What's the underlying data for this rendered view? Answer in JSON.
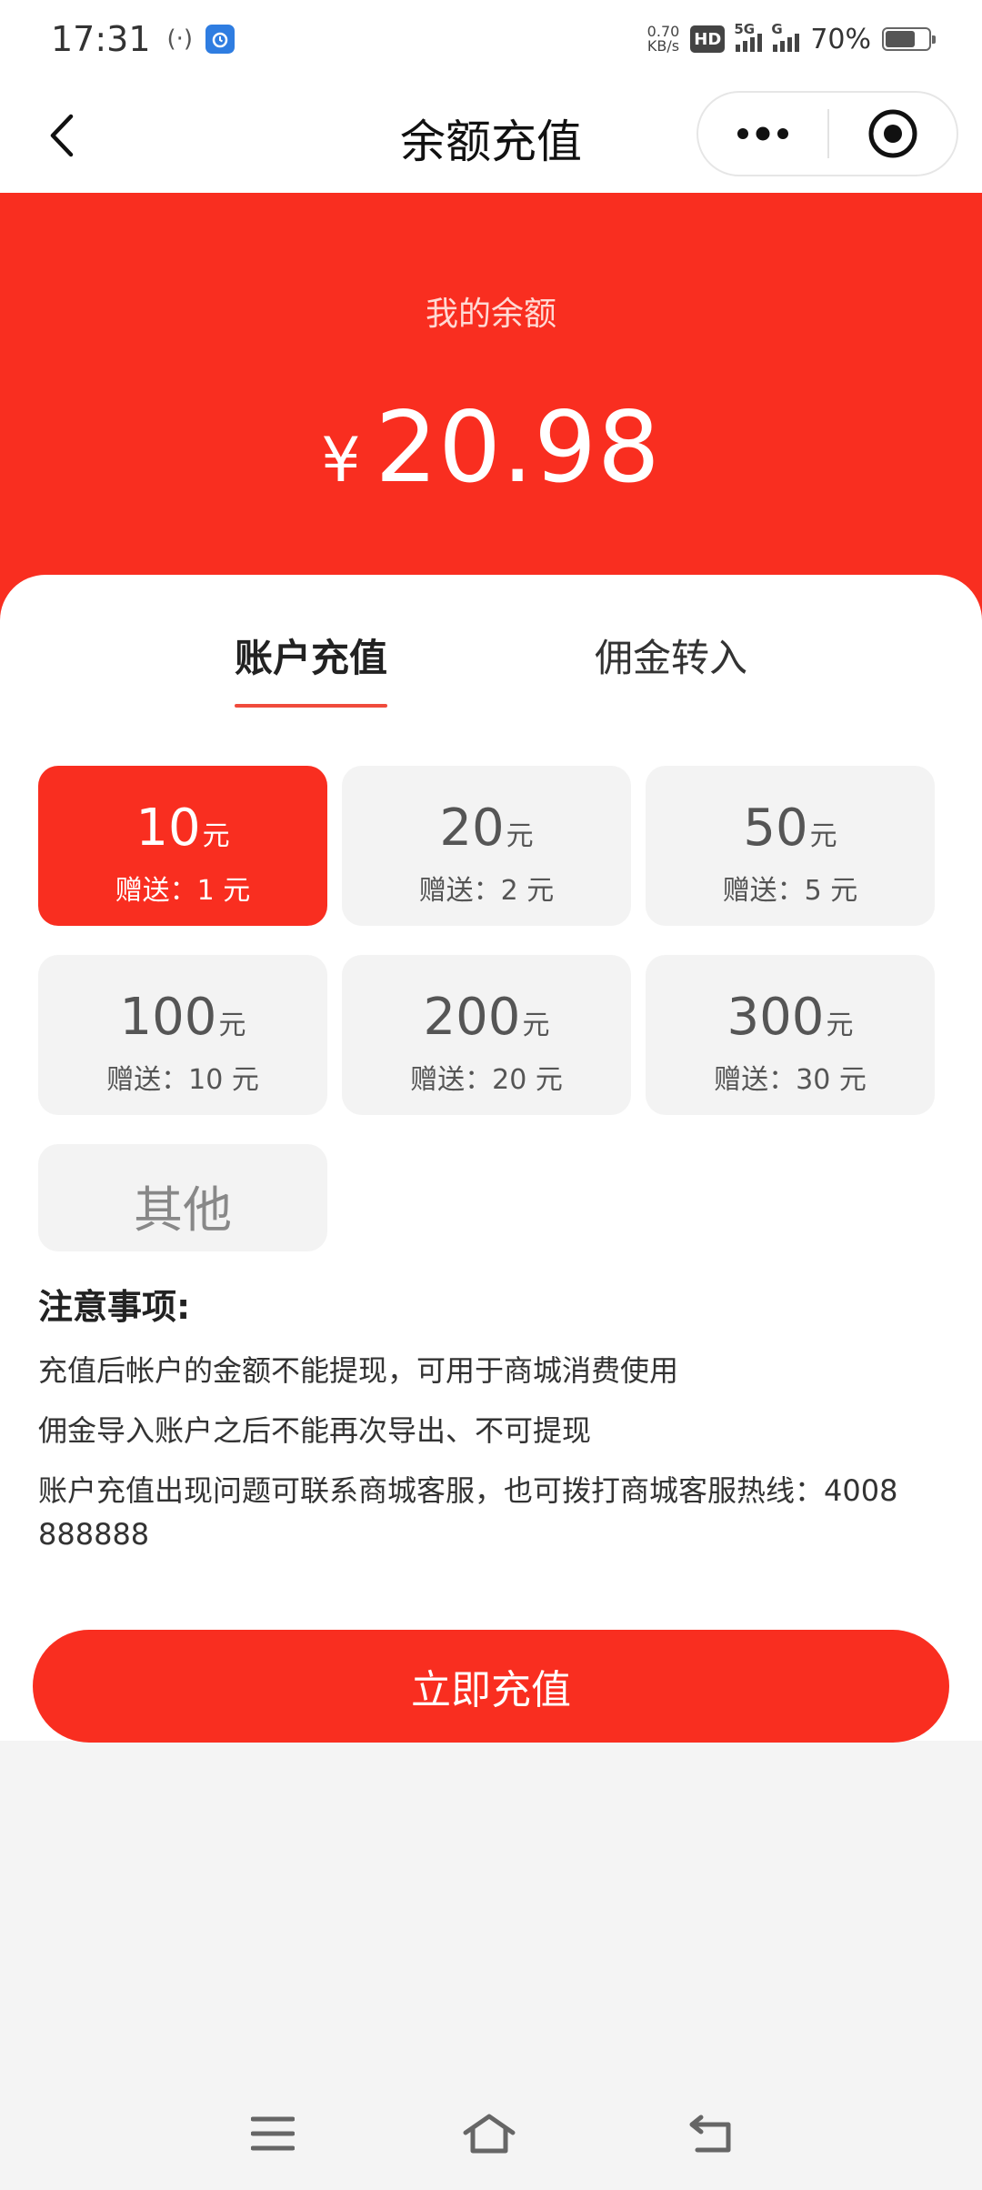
{
  "status_bar": {
    "time": "17:31",
    "speed_value": "0.70",
    "speed_unit": "KB/s",
    "hd_label": "HD",
    "signal1_label": "5G",
    "signal2_label": "G",
    "battery_percent": "70%",
    "battery_level": 0.7
  },
  "nav": {
    "title": "余额充值"
  },
  "balance": {
    "label": "我的余额",
    "currency": "¥",
    "amount": "20.98"
  },
  "tabs": [
    {
      "label": "账户充值",
      "active": true
    },
    {
      "label": "佣金转入",
      "active": false
    }
  ],
  "options": [
    {
      "amount": "10",
      "unit": "元",
      "bonus": "赠送：1 元",
      "selected": true
    },
    {
      "amount": "20",
      "unit": "元",
      "bonus": "赠送：2 元",
      "selected": false
    },
    {
      "amount": "50",
      "unit": "元",
      "bonus": "赠送：5 元",
      "selected": false
    },
    {
      "amount": "100",
      "unit": "元",
      "bonus": "赠送：10 元",
      "selected": false
    },
    {
      "amount": "200",
      "unit": "元",
      "bonus": "赠送：20 元",
      "selected": false
    },
    {
      "amount": "300",
      "unit": "元",
      "bonus": "赠送：30 元",
      "selected": false
    }
  ],
  "other_option": "其他",
  "notes": {
    "title": "注意事项:",
    "lines": [
      "充值后帐户的金额不能提现，可用于商城消费使用",
      "佣金导入账户之后不能再次导出、不可提现",
      "账户充值出现问题可联系商城客服，也可拨打商城客服热线：4008888888"
    ]
  },
  "submit_label": "立即充值",
  "colors": {
    "accent": "#f92e20",
    "option_bg": "#f3f3f3",
    "page_bg": "#f4f4f4"
  }
}
